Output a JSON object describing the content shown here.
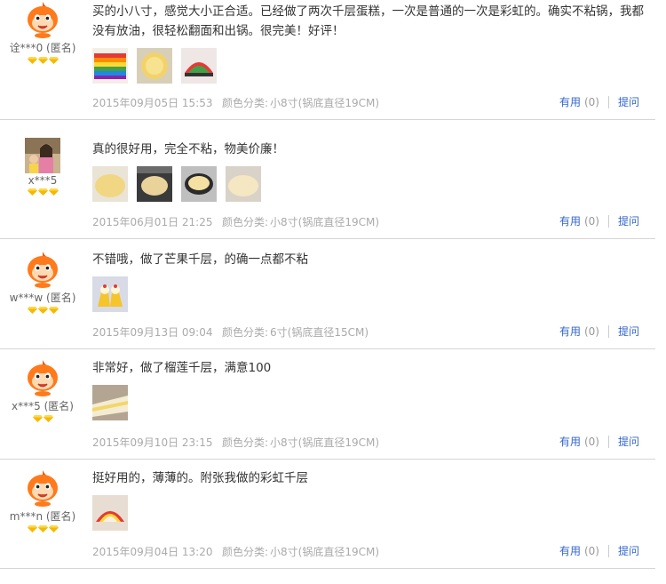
{
  "reviews": [
    {
      "avatar": "taobao-cartoon-avatar",
      "username": "诠***0 (匿名)",
      "level_diamonds": 3,
      "text": "买的小八寸，感觉大小正合适。已经做了两次千层蛋糕，一次是普通的一次是彩虹的。确实不粘锅，我都没有放油，很轻松翻面和出锅。很完美！好评！",
      "thumbnails": 3,
      "date": "2015年09月05日 15:53",
      "spec_label": "颜色分类:",
      "spec_value": "小8寸(锅底直径19CM)",
      "useful_label": "有用",
      "useful_count": "(0)",
      "ask_label": "提问"
    },
    {
      "avatar": "user-photo-avatar",
      "username": "x***5",
      "level_diamonds": 3,
      "text": "真的很好用，完全不粘，物美价廉！",
      "thumbnails": 4,
      "date": "2015年06月01日 21:25",
      "spec_label": "颜色分类:",
      "spec_value": "小8寸(锅底直径19CM)",
      "useful_label": "有用",
      "useful_count": "(0)",
      "ask_label": "提问"
    },
    {
      "avatar": "taobao-cartoon-avatar",
      "username": "w***w (匿名)",
      "level_diamonds": 3,
      "text": "不错哦，做了芒果千层，的确一点都不粘",
      "thumbnails": 1,
      "date": "2015年09月13日 09:04",
      "spec_label": "颜色分类:",
      "spec_value": "6寸(锅底直径15CM)",
      "useful_label": "有用",
      "useful_count": "(0)",
      "ask_label": "提问"
    },
    {
      "avatar": "taobao-cartoon-avatar",
      "username": "x***5 (匿名)",
      "level_diamonds": 2,
      "text": "非常好，做了榴莲千层，满意100",
      "thumbnails": 1,
      "date": "2015年09月10日 23:15",
      "spec_label": "颜色分类:",
      "spec_value": "小8寸(锅底直径19CM)",
      "useful_label": "有用",
      "useful_count": "(0)",
      "ask_label": "提问"
    },
    {
      "avatar": "taobao-cartoon-avatar",
      "username": "m***n (匿名)",
      "level_diamonds": 3,
      "text": "挺好用的，薄薄的。附张我做的彩虹千层",
      "thumbnails": 1,
      "date": "2015年09月04日 13:20",
      "spec_label": "颜色分类:",
      "spec_value": "小8寸(锅底直径19CM)",
      "useful_label": "有用",
      "useful_count": "(0)",
      "ask_label": "提问"
    }
  ],
  "colors": {
    "link": "#3366cc",
    "meta_text": "#aaaaaa",
    "diamond": "#f5b800",
    "divider": "#d6d6d6"
  }
}
